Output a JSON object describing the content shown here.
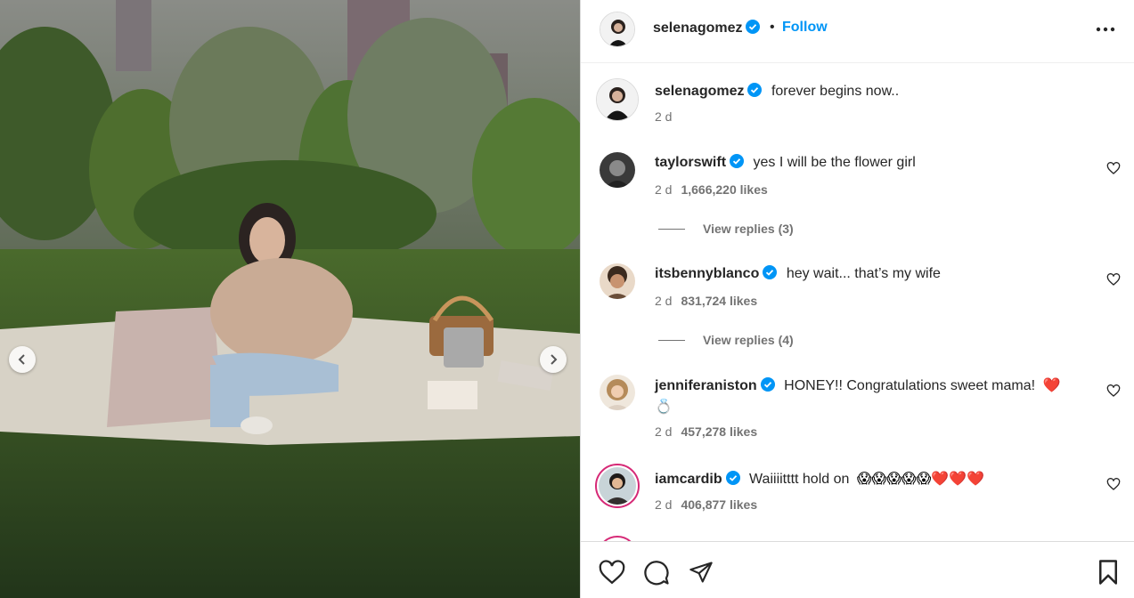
{
  "post": {
    "username": "selenagomez",
    "separator": "•",
    "follow_label": "Follow",
    "more_icon": "more-horizontal-icon"
  },
  "caption": {
    "username": "selenagomez",
    "text": "forever begins now..",
    "time": "2 d"
  },
  "comments": [
    {
      "username": "taylorswift",
      "text": "yes I will be the flower girl",
      "time": "2 d",
      "likes": "1,666,220 likes",
      "replies": "View replies (3)"
    },
    {
      "username": "itsbennyblanco",
      "text": "hey wait... that’s my wife",
      "time": "2 d",
      "likes": "831,724 likes",
      "replies": "View replies (4)"
    },
    {
      "username": "jenniferaniston",
      "text": "HONEY!! Congratulations sweet mama!",
      "emoji": "❤️ 💍",
      "time": "2 d",
      "likes": "457,278 likes"
    },
    {
      "username": "iamcardib",
      "text": "Waiiiitttt hold on",
      "emoji": "😱😱😱😱😱❤️❤️❤️",
      "time": "2 d",
      "likes": "406,877 likes"
    }
  ],
  "colors": {
    "accent": "#0095f6",
    "verified": "#0095f6",
    "text": "#262626",
    "muted": "#737373",
    "story_ring": "#d62976"
  }
}
